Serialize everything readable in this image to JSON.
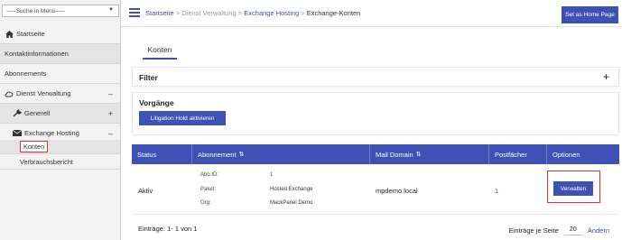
{
  "sidebar": {
    "search_placeholder": "-----Suche in Menü-----",
    "items": [
      {
        "label": "Startseite"
      },
      {
        "label": "Kontaktinformationen"
      },
      {
        "label": "Abonnements"
      },
      {
        "label": "Dienst Verwaltung",
        "toggle": "–"
      },
      {
        "label": "Generell",
        "toggle": "+"
      },
      {
        "label": "Exchange Hosting",
        "toggle": "–"
      },
      {
        "label": "Konten"
      },
      {
        "label": "Verbrauchsbericht"
      }
    ]
  },
  "header": {
    "breadcrumb": {
      "home": "Startseite",
      "sep": " > ",
      "service": "Dienst Verwaltung",
      "exchange": "Exchange Hosting",
      "current": "Exchange-Konten"
    },
    "home_button": "Set as Home Page"
  },
  "main": {
    "tab": "Konten",
    "filter_title": "Filter",
    "filter_toggle": "+",
    "vorgaenge_title": "Vorgänge",
    "litigation_button": "Litigation Hold aktivieren"
  },
  "table": {
    "headers": {
      "status": "Status",
      "abonnement": "Abonnement",
      "mail_domain": "Mail Domain",
      "postfaecher": "Postfächer",
      "optionen": "Optionen"
    },
    "sort_icon": "⇅",
    "rows": [
      {
        "status": "Aktiv",
        "abo_id_label": "Abo.ID:",
        "abo_id": "1",
        "paket_label": "Paket:",
        "paket": "Hosted Exchange",
        "org_label": "Org:",
        "org": "MackPanel Demo",
        "mail_domain": "mpdemo.local",
        "postfaecher": "1",
        "action": "Verwalten"
      }
    ]
  },
  "footer": {
    "entries": "Einträge: 1- 1 von 1",
    "per_page_label": "Einträge je Seite",
    "per_page_value": "20",
    "change_link": "Ändern"
  },
  "colors": {
    "accent": "#3f51b5",
    "highlight": "#d9342b"
  }
}
